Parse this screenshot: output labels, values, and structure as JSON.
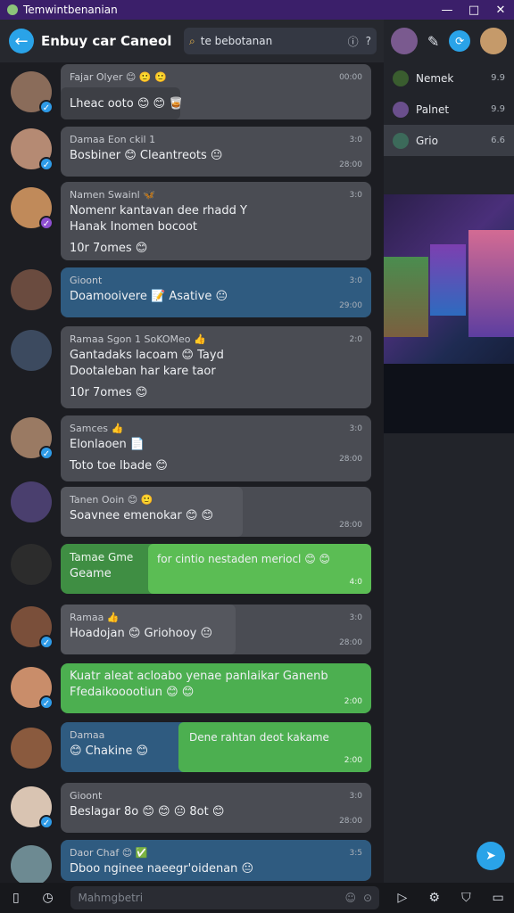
{
  "window": {
    "title": "Temwintbenanian"
  },
  "header": {
    "back_icon": "arrow-left-icon",
    "title": "Enbuy car Caneol"
  },
  "search": {
    "value": "te bebotanan"
  },
  "sidebar": {
    "items": [
      {
        "label": "Nemek",
        "value": "9.9",
        "color": "#3a5d2f"
      },
      {
        "label": "Palnet",
        "value": "9.9",
        "color": "#6a4f8c"
      },
      {
        "label": "Grio",
        "value": "6.6",
        "color": "#3c6a5a"
      }
    ]
  },
  "messages": [
    {
      "name": "Fajar Olyer 😊 🙂 🙂",
      "time": "00:00",
      "line1": "Lheac ooto 😊 😊 🥃",
      "line2": "",
      "stamp": ""
    },
    {
      "name": "Damaa Eon ckil 1",
      "time": "3:0",
      "line1": "Bosbiner 😊 Cleantreots 😐",
      "line2": "",
      "stamp": "28:00"
    },
    {
      "name": "Namen Swainl 🦋",
      "time": "3:0",
      "line1": "Nomenr kantavan dee rhadd Y",
      "line2": "Hanak Inomen bocoot",
      "line3": "10r 7omes 😊",
      "stamp": ""
    },
    {
      "name": "Gioont",
      "time": "3:0",
      "line1": "Doamooivere 📝 Asative 😐",
      "line2": "",
      "stamp": "29:00"
    },
    {
      "name": "Ramaa Sgon 1 SoKOMeo 👍",
      "time": "2:0",
      "line1": "Gantadaks lacoam 😊 Tayd",
      "line2": "Dootaleban har kare taor",
      "line3": "10r 7omes 😊",
      "stamp": ""
    },
    {
      "name": "Samces 👍",
      "time": "3:0",
      "line1": "Elonlaoen 📄",
      "line2": "Toto toe lbade 😊",
      "stamp": "28:00"
    },
    {
      "name": "Tanen Ooin 😊 🙂",
      "time": "",
      "line1": "Soavnee emenokar 😊 😊",
      "line2": "",
      "stamp": "28:00"
    },
    {
      "name": "Tamae Gme",
      "time": "",
      "line1": "Geame",
      "green": "for cintio nestaden meriocl 😊 😊",
      "stamp": "4:0"
    },
    {
      "name": "Ramaa 👍",
      "time": "3:0",
      "line1": "Hoadojan 😊 Griohooy 😐",
      "line2": "",
      "stamp": "28:00"
    },
    {
      "green_full": "Kuatr aleat acloabo yenae panlaikar Ganenb",
      "line2": "Ffedaikooootiun 😊 😊",
      "stamp": "2:00"
    },
    {
      "name": "Damaa",
      "time": "",
      "line1": "😊 Chakine 😊",
      "green": "Dene rahtan deot kakame",
      "stamp": "2:00"
    },
    {
      "name": "Gioont",
      "time": "3:0",
      "line1": "Beslagar 8o 😊 😊 😐 8ot 😊",
      "line2": "",
      "stamp": "28:00"
    },
    {
      "name": "Daor Chaf 😊 ✅",
      "time": "3:5",
      "line1": "Dboo nginee naeegr'oidenan 😐",
      "line2": "",
      "stamp": ""
    }
  ],
  "compose": {
    "placeholder": "Mahmgbetri"
  },
  "bottom": {
    "left_icons": [
      "book-icon",
      "clock-icon"
    ],
    "right_icons": [
      "play-icon",
      "settings-icon",
      "bag-icon",
      "box-icon"
    ]
  },
  "colors": {
    "accent": "#2aa3e8",
    "green": "#4caf50",
    "blue": "#2f5b80",
    "bubble": "#4a4c53",
    "title_bar": "#3b1f6a"
  }
}
